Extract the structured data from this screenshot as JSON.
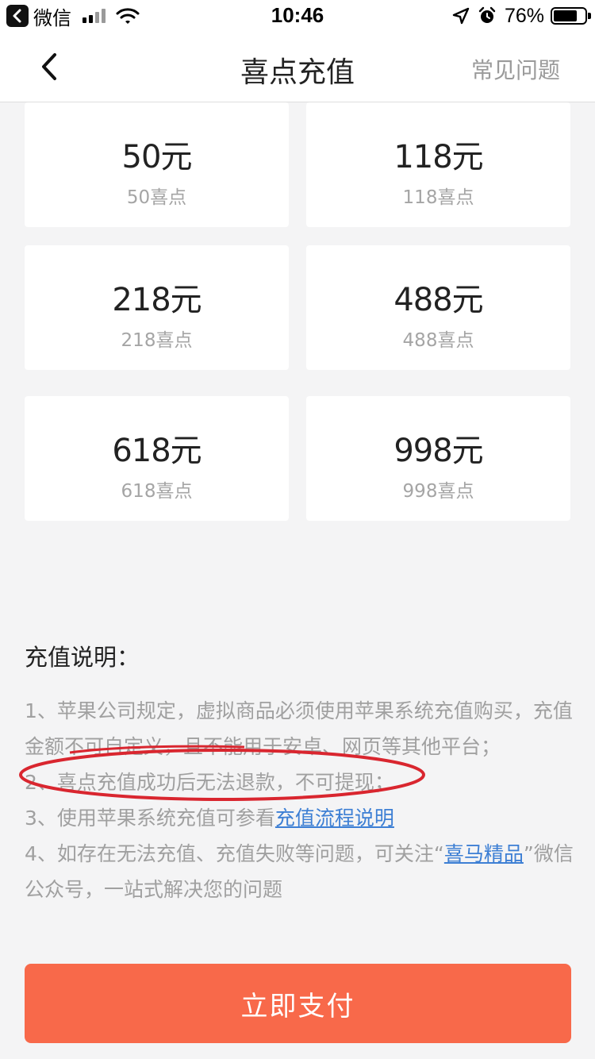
{
  "status_bar": {
    "back_app": "微信",
    "time": "10:46",
    "battery": "76%"
  },
  "nav": {
    "title": "喜点充值",
    "faq": "常见问题",
    "back_icon": "chevron-left-icon"
  },
  "packages": [
    {
      "price": "50元",
      "points": "50喜点"
    },
    {
      "price": "118元",
      "points": "118喜点"
    },
    {
      "price": "218元",
      "points": "218喜点"
    },
    {
      "price": "488元",
      "points": "488喜点"
    },
    {
      "price": "618元",
      "points": "618喜点"
    },
    {
      "price": "998元",
      "points": "998喜点"
    }
  ],
  "notes": {
    "title": "充值说明：",
    "line1": "1、苹果公司规定，虚拟商品必须使用苹果系统充值购买，充值金额不可自定义，且不能用于安卓、网页等其他平台；",
    "line2": "2、喜点充值成功后无法退款，不可提现；",
    "line3_prefix": "3、使用苹果系统充值可参看",
    "line3_link": "充值流程说明",
    "line4_prefix": "4、如存在无法充值、充值失败等问题，可关注“",
    "line4_link": "喜马精品",
    "line4_suffix": "”微信公众号，一站式解决您的问题"
  },
  "pay_button": "立即支付",
  "colors": {
    "accent": "#f8694a",
    "link": "#3d7fd4",
    "annotation": "#d9262f"
  }
}
